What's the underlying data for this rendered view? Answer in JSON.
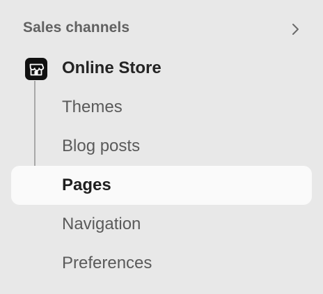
{
  "sidebar": {
    "section_title": "Sales channels",
    "parent_item": {
      "label": "Online Store",
      "icon": "storefront-icon"
    },
    "items": [
      {
        "label": "Themes",
        "active": false
      },
      {
        "label": "Blog posts",
        "active": false
      },
      {
        "label": "Pages",
        "active": true
      },
      {
        "label": "Navigation",
        "active": false
      },
      {
        "label": "Preferences",
        "active": false
      }
    ]
  },
  "colors": {
    "background": "#e8e8e8",
    "active_item_bg": "#fafafa",
    "muted_text": "#5a5a5a",
    "strong_text": "#1f1f1f",
    "connector": "#a8a8a8"
  }
}
